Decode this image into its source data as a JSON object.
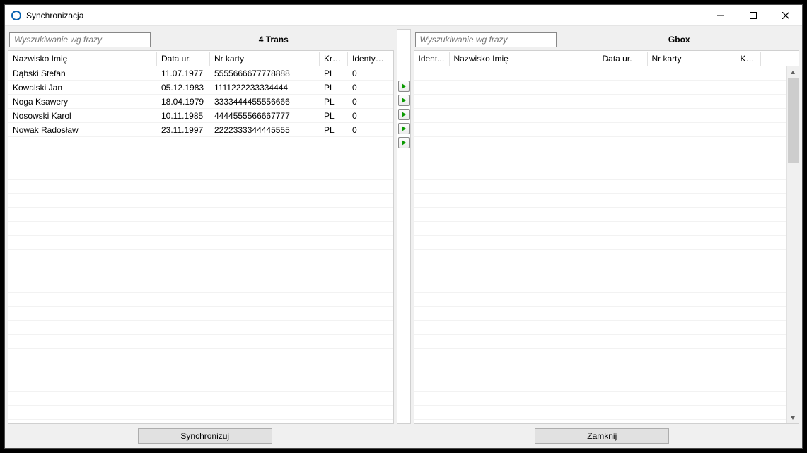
{
  "window": {
    "title": "Synchronizacja"
  },
  "left_panel": {
    "search_placeholder": "Wyszukiwanie wg frazy",
    "title": "4 Trans",
    "columns": [
      "Nazwisko Imię",
      "Data ur.",
      "Nr karty",
      "Kraj...",
      "Identyfi..."
    ],
    "rows": [
      {
        "name": "Dąbski Stefan",
        "dob": "11.07.1977",
        "card": "5555666677778888",
        "country": "PL",
        "ident": "0"
      },
      {
        "name": "Kowalski Jan",
        "dob": "05.12.1983",
        "card": "1111222233334444",
        "country": "PL",
        "ident": "0"
      },
      {
        "name": "Noga Ksawery",
        "dob": "18.04.1979",
        "card": "3333444455556666",
        "country": "PL",
        "ident": "0"
      },
      {
        "name": "Nosowski Karol",
        "dob": "10.11.1985",
        "card": "4444555566667777",
        "country": "PL",
        "ident": "0"
      },
      {
        "name": "Nowak Radosław",
        "dob": "23.11.1997",
        "card": "2222333344445555",
        "country": "PL",
        "ident": "0"
      }
    ]
  },
  "right_panel": {
    "search_placeholder": "Wyszukiwanie wg frazy",
    "title": "Gbox",
    "columns": [
      "Ident...",
      "Nazwisko Imię",
      "Data ur.",
      "Nr karty",
      "Kraj..."
    ],
    "rows": []
  },
  "buttons": {
    "sync": "Synchronizuj",
    "close": "Zamknij"
  }
}
